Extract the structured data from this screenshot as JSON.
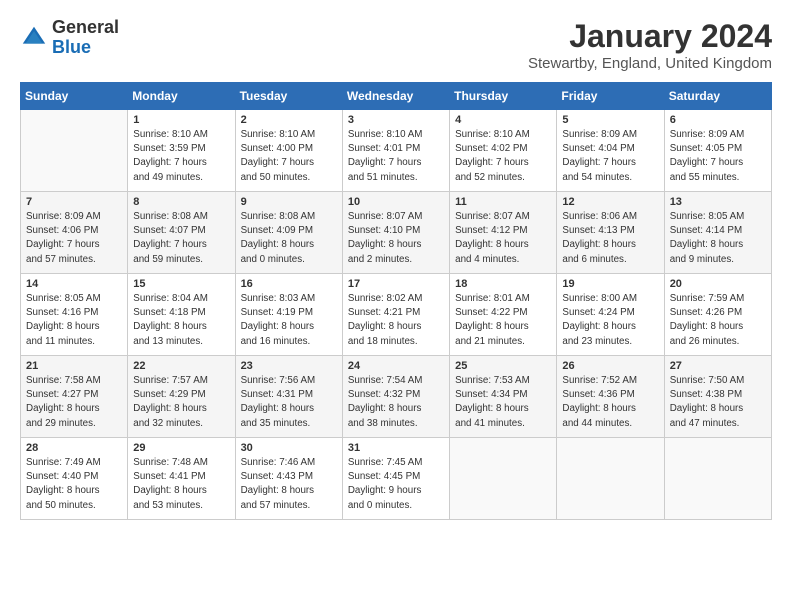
{
  "logo": {
    "general": "General",
    "blue": "Blue"
  },
  "title": "January 2024",
  "subtitle": "Stewartby, England, United Kingdom",
  "headers": [
    "Sunday",
    "Monday",
    "Tuesday",
    "Wednesday",
    "Thursday",
    "Friday",
    "Saturday"
  ],
  "weeks": [
    [
      {
        "day": "",
        "content": ""
      },
      {
        "day": "1",
        "content": "Sunrise: 8:10 AM\nSunset: 3:59 PM\nDaylight: 7 hours\nand 49 minutes."
      },
      {
        "day": "2",
        "content": "Sunrise: 8:10 AM\nSunset: 4:00 PM\nDaylight: 7 hours\nand 50 minutes."
      },
      {
        "day": "3",
        "content": "Sunrise: 8:10 AM\nSunset: 4:01 PM\nDaylight: 7 hours\nand 51 minutes."
      },
      {
        "day": "4",
        "content": "Sunrise: 8:10 AM\nSunset: 4:02 PM\nDaylight: 7 hours\nand 52 minutes."
      },
      {
        "day": "5",
        "content": "Sunrise: 8:09 AM\nSunset: 4:04 PM\nDaylight: 7 hours\nand 54 minutes."
      },
      {
        "day": "6",
        "content": "Sunrise: 8:09 AM\nSunset: 4:05 PM\nDaylight: 7 hours\nand 55 minutes."
      }
    ],
    [
      {
        "day": "7",
        "content": "Sunrise: 8:09 AM\nSunset: 4:06 PM\nDaylight: 7 hours\nand 57 minutes."
      },
      {
        "day": "8",
        "content": "Sunrise: 8:08 AM\nSunset: 4:07 PM\nDaylight: 7 hours\nand 59 minutes."
      },
      {
        "day": "9",
        "content": "Sunrise: 8:08 AM\nSunset: 4:09 PM\nDaylight: 8 hours\nand 0 minutes."
      },
      {
        "day": "10",
        "content": "Sunrise: 8:07 AM\nSunset: 4:10 PM\nDaylight: 8 hours\nand 2 minutes."
      },
      {
        "day": "11",
        "content": "Sunrise: 8:07 AM\nSunset: 4:12 PM\nDaylight: 8 hours\nand 4 minutes."
      },
      {
        "day": "12",
        "content": "Sunrise: 8:06 AM\nSunset: 4:13 PM\nDaylight: 8 hours\nand 6 minutes."
      },
      {
        "day": "13",
        "content": "Sunrise: 8:05 AM\nSunset: 4:14 PM\nDaylight: 8 hours\nand 9 minutes."
      }
    ],
    [
      {
        "day": "14",
        "content": "Sunrise: 8:05 AM\nSunset: 4:16 PM\nDaylight: 8 hours\nand 11 minutes."
      },
      {
        "day": "15",
        "content": "Sunrise: 8:04 AM\nSunset: 4:18 PM\nDaylight: 8 hours\nand 13 minutes."
      },
      {
        "day": "16",
        "content": "Sunrise: 8:03 AM\nSunset: 4:19 PM\nDaylight: 8 hours\nand 16 minutes."
      },
      {
        "day": "17",
        "content": "Sunrise: 8:02 AM\nSunset: 4:21 PM\nDaylight: 8 hours\nand 18 minutes."
      },
      {
        "day": "18",
        "content": "Sunrise: 8:01 AM\nSunset: 4:22 PM\nDaylight: 8 hours\nand 21 minutes."
      },
      {
        "day": "19",
        "content": "Sunrise: 8:00 AM\nSunset: 4:24 PM\nDaylight: 8 hours\nand 23 minutes."
      },
      {
        "day": "20",
        "content": "Sunrise: 7:59 AM\nSunset: 4:26 PM\nDaylight: 8 hours\nand 26 minutes."
      }
    ],
    [
      {
        "day": "21",
        "content": "Sunrise: 7:58 AM\nSunset: 4:27 PM\nDaylight: 8 hours\nand 29 minutes."
      },
      {
        "day": "22",
        "content": "Sunrise: 7:57 AM\nSunset: 4:29 PM\nDaylight: 8 hours\nand 32 minutes."
      },
      {
        "day": "23",
        "content": "Sunrise: 7:56 AM\nSunset: 4:31 PM\nDaylight: 8 hours\nand 35 minutes."
      },
      {
        "day": "24",
        "content": "Sunrise: 7:54 AM\nSunset: 4:32 PM\nDaylight: 8 hours\nand 38 minutes."
      },
      {
        "day": "25",
        "content": "Sunrise: 7:53 AM\nSunset: 4:34 PM\nDaylight: 8 hours\nand 41 minutes."
      },
      {
        "day": "26",
        "content": "Sunrise: 7:52 AM\nSunset: 4:36 PM\nDaylight: 8 hours\nand 44 minutes."
      },
      {
        "day": "27",
        "content": "Sunrise: 7:50 AM\nSunset: 4:38 PM\nDaylight: 8 hours\nand 47 minutes."
      }
    ],
    [
      {
        "day": "28",
        "content": "Sunrise: 7:49 AM\nSunset: 4:40 PM\nDaylight: 8 hours\nand 50 minutes."
      },
      {
        "day": "29",
        "content": "Sunrise: 7:48 AM\nSunset: 4:41 PM\nDaylight: 8 hours\nand 53 minutes."
      },
      {
        "day": "30",
        "content": "Sunrise: 7:46 AM\nSunset: 4:43 PM\nDaylight: 8 hours\nand 57 minutes."
      },
      {
        "day": "31",
        "content": "Sunrise: 7:45 AM\nSunset: 4:45 PM\nDaylight: 9 hours\nand 0 minutes."
      },
      {
        "day": "",
        "content": ""
      },
      {
        "day": "",
        "content": ""
      },
      {
        "day": "",
        "content": ""
      }
    ]
  ]
}
